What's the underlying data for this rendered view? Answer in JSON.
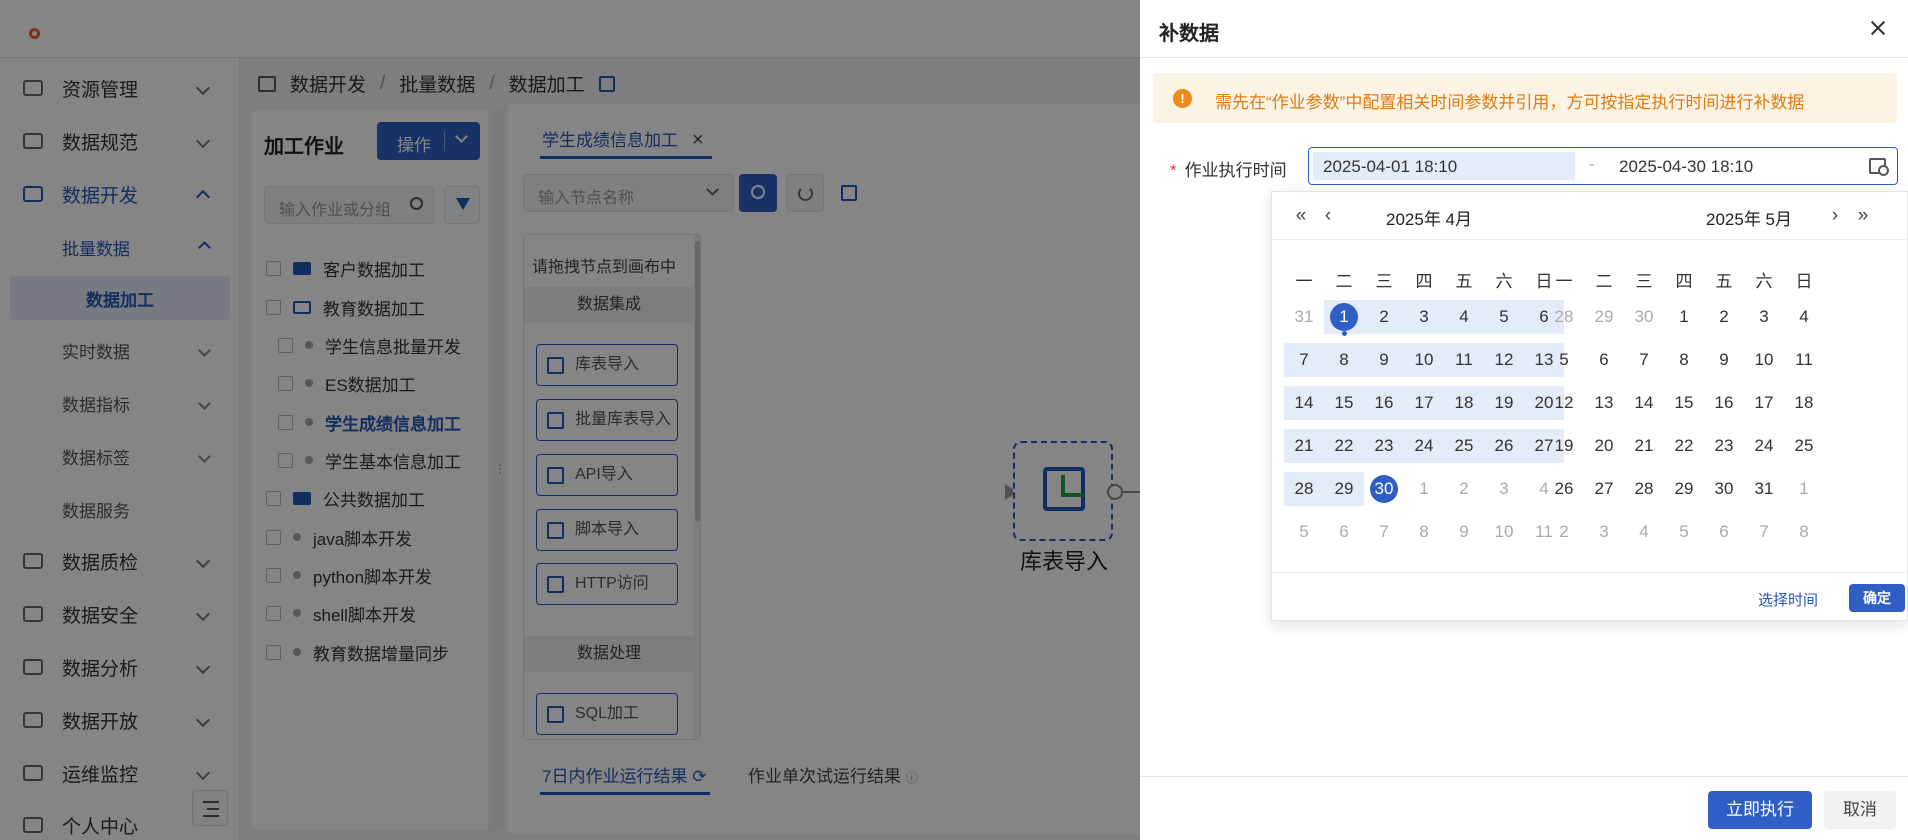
{
  "sidebar": {
    "items": [
      {
        "label": "资源管理",
        "icon": "server-icon"
      },
      {
        "label": "数据规范",
        "icon": "monitor-icon"
      },
      {
        "label": "数据开发",
        "icon": "code-icon",
        "active": true
      },
      {
        "label": "数据质检",
        "icon": "check-icon"
      },
      {
        "label": "数据安全",
        "icon": "chart-icon"
      },
      {
        "label": "数据分析",
        "icon": "analysis-icon"
      },
      {
        "label": "数据开放",
        "icon": "share-icon"
      },
      {
        "label": "运维监控",
        "icon": "trend-icon"
      },
      {
        "label": "个人中心",
        "icon": "user-icon"
      }
    ],
    "sub_items": [
      {
        "label": "批量数据"
      },
      {
        "label": "数据加工"
      },
      {
        "label": "实时数据"
      },
      {
        "label": "数据指标"
      },
      {
        "label": "数据标签"
      },
      {
        "label": "数据服务"
      }
    ]
  },
  "breadcrumb": {
    "items": [
      "数据开发",
      "批量数据",
      "数据加工"
    ],
    "separator": "/"
  },
  "jobs": {
    "title": "加工作业",
    "op_button": "操作",
    "search_placeholder": "输入作业或分组",
    "tree": [
      {
        "label": "客户数据加工",
        "type": "folder"
      },
      {
        "label": "教育数据加工",
        "type": "folder-open"
      },
      {
        "label": "学生信息批量开发",
        "type": "leaf"
      },
      {
        "label": "ES数据加工",
        "type": "leaf"
      },
      {
        "label": "学生成绩信息加工",
        "type": "leaf",
        "selected": true
      },
      {
        "label": "学生基本信息加工",
        "type": "leaf"
      },
      {
        "label": "公共数据加工",
        "type": "folder"
      },
      {
        "label": "java脚本开发",
        "type": "job"
      },
      {
        "label": "python脚本开发",
        "type": "job"
      },
      {
        "label": "shell脚本开发",
        "type": "job"
      },
      {
        "label": "教育数据增量同步",
        "type": "job"
      }
    ]
  },
  "canvas": {
    "tab_label": "学生成绩信息加工",
    "node_search_placeholder": "输入节点名称",
    "palette": {
      "hint": "请拖拽节点到画布中",
      "group1": "数据集成",
      "buttons1": [
        "库表导入",
        "批量库表导入",
        "API导入",
        "脚本导入",
        "HTTP访问"
      ],
      "group2": "数据处理",
      "buttons2": [
        "SQL加工"
      ]
    },
    "node_label": "库表导入",
    "bottom_tab1": "7日内作业运行结果",
    "bottom_tab2": "作业单次试运行结果"
  },
  "drawer": {
    "title": "补数据",
    "alert": "需先在“作业参数”中配置相关时间参数并引用，方可按指定执行时间进行补数据",
    "field_label": "作业执行时间",
    "start_value": "2025-04-01 18:10",
    "range_separator": "-",
    "end_value": "2025-04-30 18:10",
    "run_button": "立即执行",
    "cancel_button": "取消"
  },
  "picker": {
    "left_title": "2025年 4月",
    "right_title": "2025年 5月",
    "weekdays": [
      "一",
      "二",
      "三",
      "四",
      "五",
      "六",
      "日"
    ],
    "left_days": [
      [
        "31",
        "1",
        "2",
        "3",
        "4",
        "5",
        "6"
      ],
      [
        "7",
        "8",
        "9",
        "10",
        "11",
        "12",
        "13"
      ],
      [
        "14",
        "15",
        "16",
        "17",
        "18",
        "19",
        "20"
      ],
      [
        "21",
        "22",
        "23",
        "24",
        "25",
        "26",
        "27"
      ],
      [
        "28",
        "29",
        "30",
        "1",
        "2",
        "3",
        "4"
      ],
      [
        "5",
        "6",
        "7",
        "8",
        "9",
        "10",
        "11"
      ]
    ],
    "right_days": [
      [
        "28",
        "29",
        "30",
        "1",
        "2",
        "3",
        "4"
      ],
      [
        "5",
        "6",
        "7",
        "8",
        "9",
        "10",
        "11"
      ],
      [
        "12",
        "13",
        "14",
        "15",
        "16",
        "17",
        "18"
      ],
      [
        "19",
        "20",
        "21",
        "22",
        "23",
        "24",
        "25"
      ],
      [
        "26",
        "27",
        "28",
        "29",
        "30",
        "31",
        "1"
      ],
      [
        "2",
        "3",
        "4",
        "5",
        "6",
        "7",
        "8"
      ]
    ],
    "select_time": "选择时间",
    "confirm": "确定",
    "colors": {
      "accent": "#2f5fc4",
      "range_bg": "#e4ecfa",
      "warning": "#e07b12"
    }
  }
}
